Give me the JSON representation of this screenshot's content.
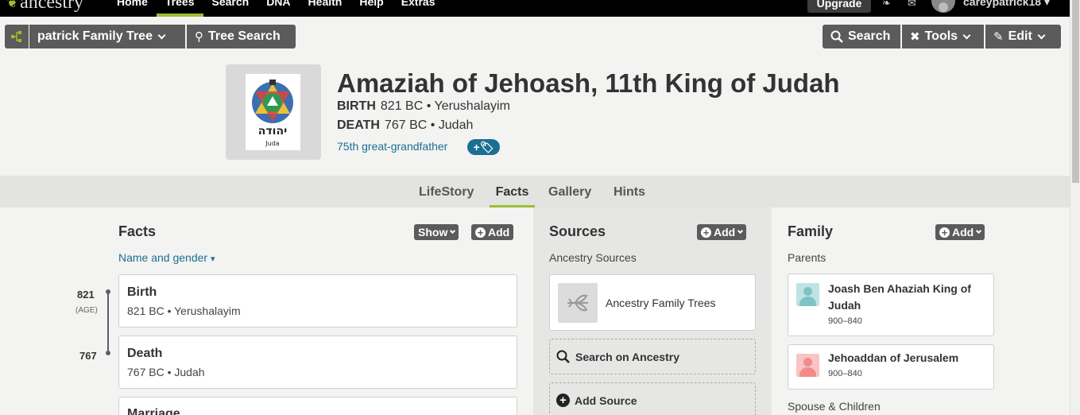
{
  "nav": {
    "logo": "ancestry",
    "links": [
      "Home",
      "Trees",
      "Search",
      "DNA",
      "Health",
      "Help",
      "Extras"
    ],
    "active": "Trees",
    "upgrade_label": "Upgrade",
    "username": "careypatrick18"
  },
  "toolbar": {
    "tree_name": "patrick Family Tree",
    "tree_search_label": "Tree Search",
    "search_label": "Search",
    "tools_label": "Tools",
    "edit_label": "Edit"
  },
  "person": {
    "name": "Amaziah of Jehoash, 11th King of Judah",
    "birth_label": "BIRTH",
    "birth_value": "821 BC • Yerushalayim",
    "death_label": "DEATH",
    "death_value": "767 BC • Judah",
    "relationship": "75th great-grandfather",
    "photo_caption": "Juda",
    "photo_hebrew": "יהודה"
  },
  "tabs": [
    "LifeStory",
    "Facts",
    "Gallery",
    "Hints"
  ],
  "active_tab": "Facts",
  "facts": {
    "heading": "Facts",
    "show_label": "Show",
    "add_label": "Add",
    "name_gender_link": "Name and gender",
    "timeline": [
      {
        "year": "821",
        "age": "(AGE)"
      },
      {
        "year": "767",
        "age": ""
      }
    ],
    "items": [
      {
        "title": "Birth",
        "detail": "821 BC • Yerushalayim"
      },
      {
        "title": "Death",
        "detail": "767 BC • Judah"
      },
      {
        "title": "Marriage",
        "detail": ""
      }
    ]
  },
  "sources": {
    "heading": "Sources",
    "add_label": "Add",
    "sublabel": "Ancestry Sources",
    "items": [
      "Ancestry Family Trees"
    ],
    "search_label": "Search on Ancestry",
    "add_source_label": "Add Source"
  },
  "family": {
    "heading": "Family",
    "add_label": "Add",
    "parents_label": "Parents",
    "parents": [
      {
        "name": "Joash Ben Ahaziah King of Judah",
        "years": "900–840",
        "color": "#7ec3c6"
      },
      {
        "name": "Jehoaddan of Jerusalem",
        "years": "900–840",
        "color": "#f28b8b"
      }
    ],
    "spouse_label": "Spouse & Children"
  },
  "colors": {
    "accent_green": "#9cbe30",
    "link_blue": "#1a6f93",
    "button_gray": "#5b5b5b"
  }
}
